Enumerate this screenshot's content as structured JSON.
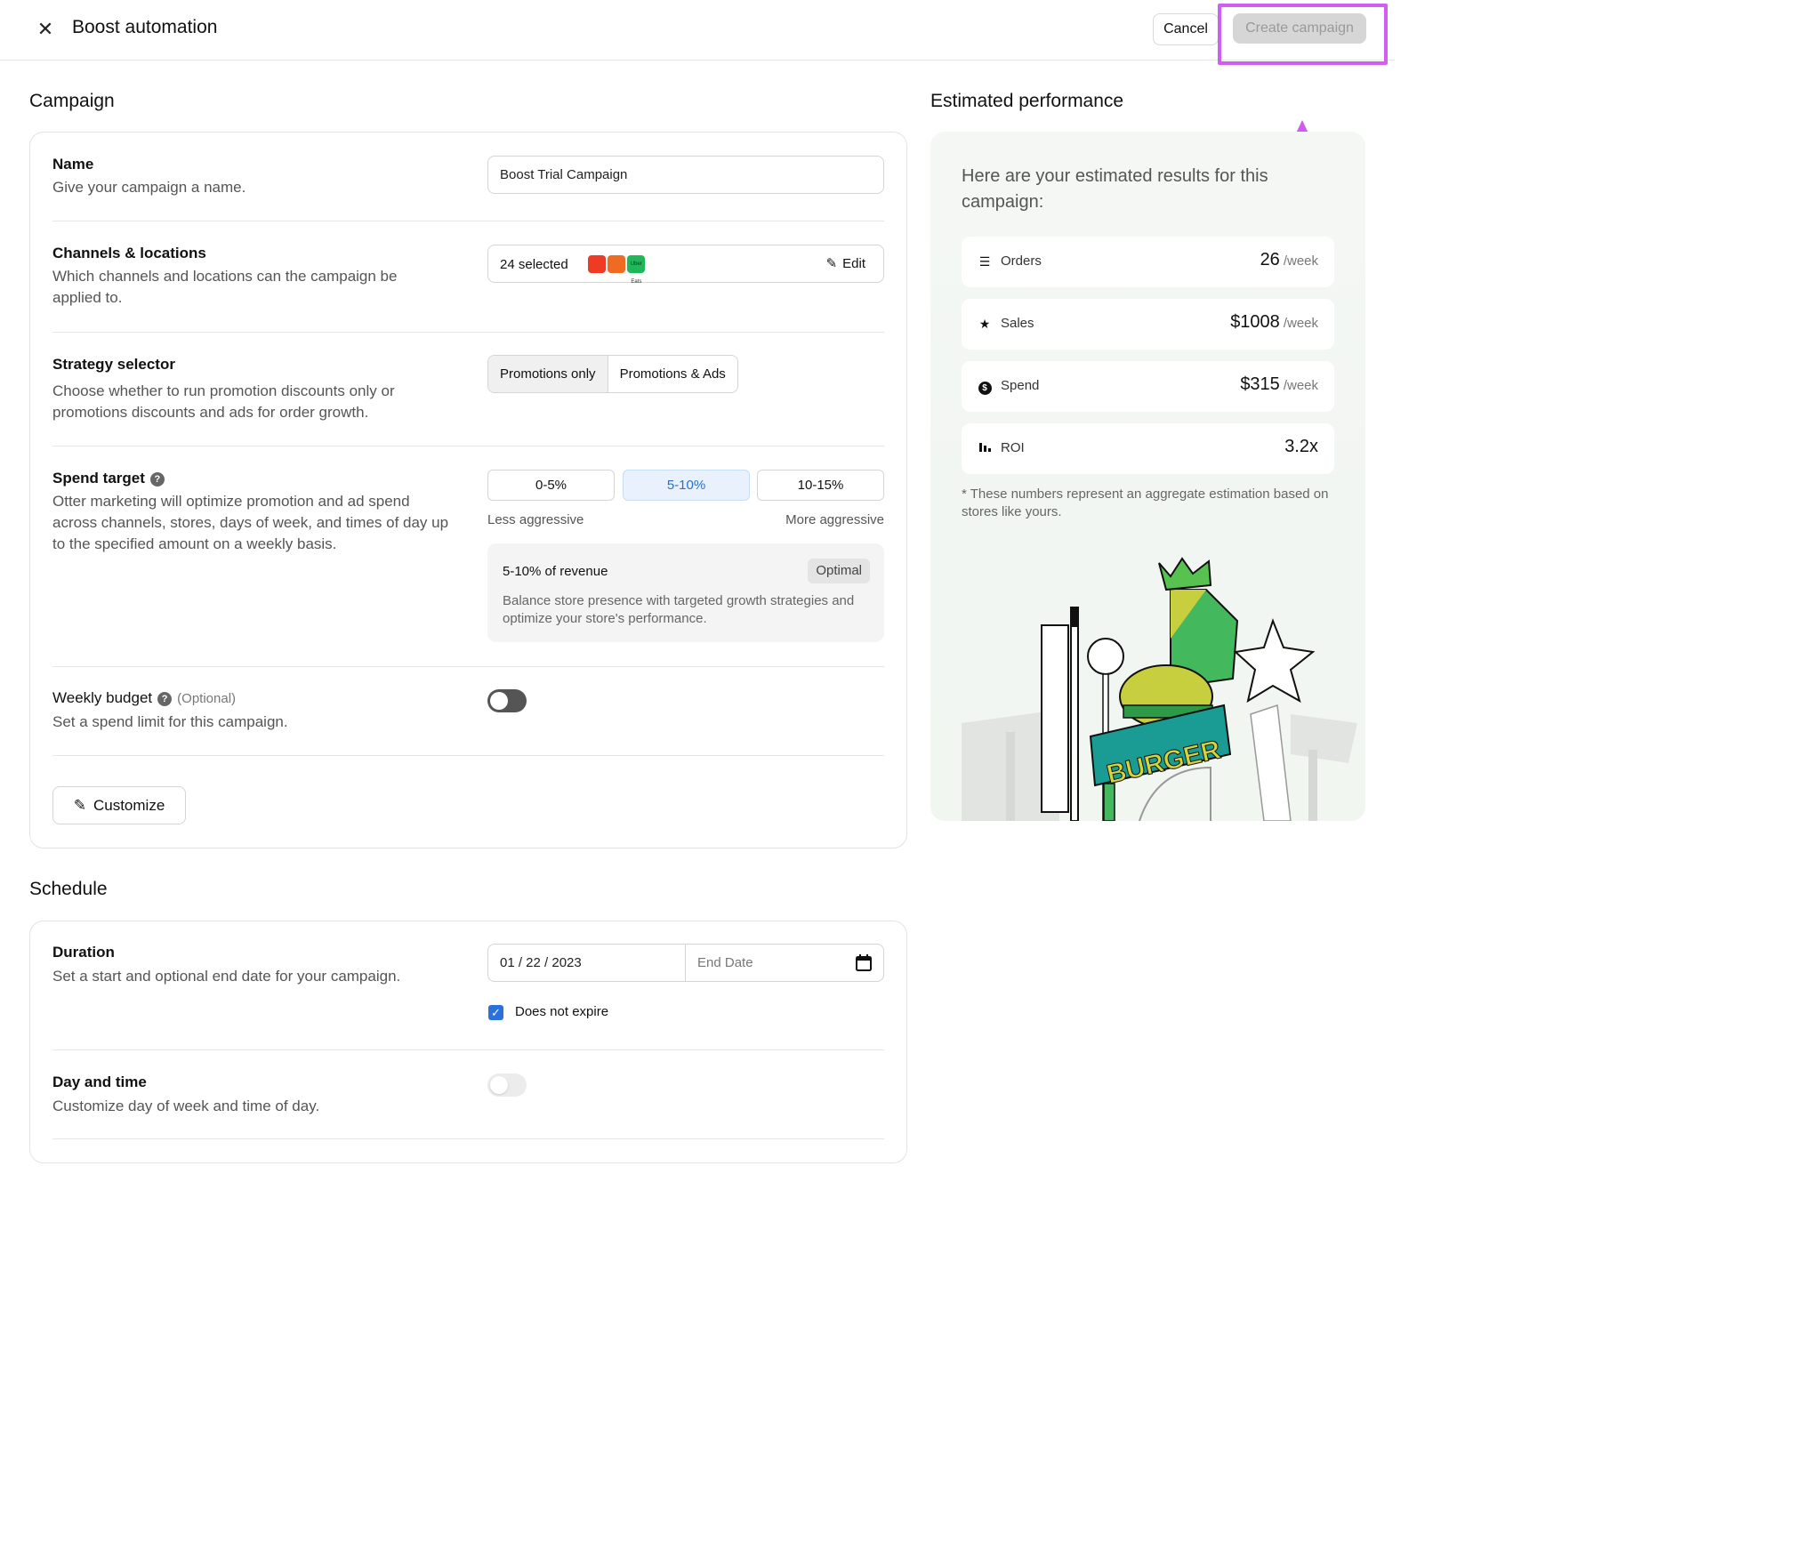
{
  "header": {
    "title": "Boost automation",
    "cancel_label": "Cancel",
    "create_label": "Create campaign"
  },
  "campaign": {
    "section_title": "Campaign",
    "name": {
      "label": "Name",
      "desc": "Give your campaign a name.",
      "value": "Boost Trial Campaign"
    },
    "channels": {
      "label": "Channels & locations",
      "desc": "Which channels and locations can the campaign be applied to.",
      "selected_text": "24 selected",
      "edit_label": "Edit",
      "chips": [
        {
          "name": "doordash-logo",
          "color": "#ef3a25"
        },
        {
          "name": "grubhub-logo",
          "color": "#f06b22"
        },
        {
          "name": "ubereats-logo",
          "color": "#1fb75a"
        }
      ],
      "chip_texts": [
        "",
        "",
        "Uber Eats"
      ]
    },
    "strategy": {
      "label": "Strategy selector",
      "desc": "Choose whether to run promotion discounts only or promotions discounts and ads for order growth.",
      "options": [
        "Promotions only",
        "Promotions & Ads"
      ],
      "selected": "Promotions only"
    },
    "spend_target": {
      "label": "Spend target",
      "desc": "Otter marketing will optimize promotion and ad spend across channels, stores, days of week, and times of day up to the specified amount on a weekly basis.",
      "options": [
        "0-5%",
        "5-10%",
        "10-15%"
      ],
      "selected": "5-10%",
      "scale_low": "Less aggressive",
      "scale_high": "More aggressive",
      "info_title": "5-10% of revenue",
      "info_badge": "Optimal",
      "info_desc": "Balance store presence with targeted growth strategies and optimize your store's performance."
    },
    "weekly_budget": {
      "label": "Weekly budget",
      "optional": "(Optional)",
      "desc": "Set a spend limit for this campaign.",
      "enabled": false
    },
    "customize_label": "Customize"
  },
  "schedule": {
    "section_title": "Schedule",
    "duration": {
      "label": "Duration",
      "desc": "Set a start and optional end date for your campaign.",
      "start_date": "01 / 22 / 2023",
      "end_placeholder": "End Date",
      "no_expire_label": "Does not expire",
      "no_expire_checked": true
    },
    "day_time": {
      "label": "Day and time",
      "desc": "Customize day of week and time of day.",
      "enabled": false
    }
  },
  "performance": {
    "section_title": "Estimated performance",
    "intro": "Here are your estimated results for this campaign:",
    "metrics": [
      {
        "icon": "orders-icon",
        "label": "Orders",
        "value": "26",
        "unit": "/week"
      },
      {
        "icon": "star-icon",
        "label": "Sales",
        "value": "$1008",
        "unit": "/week"
      },
      {
        "icon": "dollar-icon",
        "label": "Spend",
        "value": "$315",
        "unit": "/week"
      },
      {
        "icon": "bar-chart-icon",
        "label": "ROI",
        "value": "3.2x",
        "unit": ""
      }
    ],
    "note": "* These numbers represent an aggregate estimation based on stores like yours.",
    "illustration_sign_text": "BURGER"
  },
  "colors": {
    "annotation": "#d15ef0",
    "accent_blue": "#2a72d9",
    "toggle_off_dark": "#555555",
    "toggle_off_light": "#e3e3e3"
  }
}
